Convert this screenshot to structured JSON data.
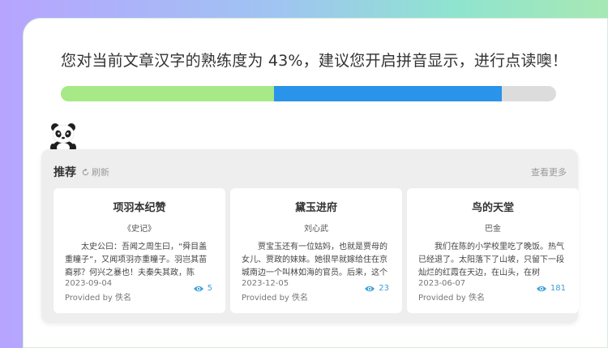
{
  "headline": "您对当前文章汉字的熟练度为 43%，建议您开启拼音显示，进行点读噢！",
  "progress": {
    "proficiency": 43,
    "secondary": 89,
    "colors": {
      "first": "#a6e986",
      "second": "#2a93ea",
      "track": "#dcdcdc"
    }
  },
  "recommend": {
    "title": "推荐",
    "refresh_label": "刷新",
    "more_label": "查看更多",
    "books": [
      {
        "title": "项羽本纪赞",
        "author": "《史记》",
        "excerpt": "太史公曰：吾闻之周生曰，“舜目盖重瞳子”，又闻项羽亦重瞳子。羽岂其苗裔邪？何兴之暴也！夫秦失其政，陈涉……",
        "date": "2023-09-04",
        "provider": "Provided by 佚名",
        "views": "5"
      },
      {
        "title": "黛玉进府",
        "author": "刘心武",
        "excerpt": "贾宝玉还有一位姑妈，也就是贾母的女儿、贾政的妹妹。她很早就嫁给住在京城南边一个叫林如海的官员。后来，这个官员……",
        "date": "2023-12-05",
        "provider": "Provided by 佚名",
        "views": "23"
      },
      {
        "title": "鸟的天堂",
        "author": "巴金",
        "excerpt": "我们在陈的小学校里吃了晚饭。热气已经退了。太阳落下了山坡，只留下一段灿烂的红霞在天边，在山头，在树梢。“我……",
        "date": "2023-06-07",
        "provider": "Provided by 佚名",
        "views": "181"
      }
    ]
  }
}
